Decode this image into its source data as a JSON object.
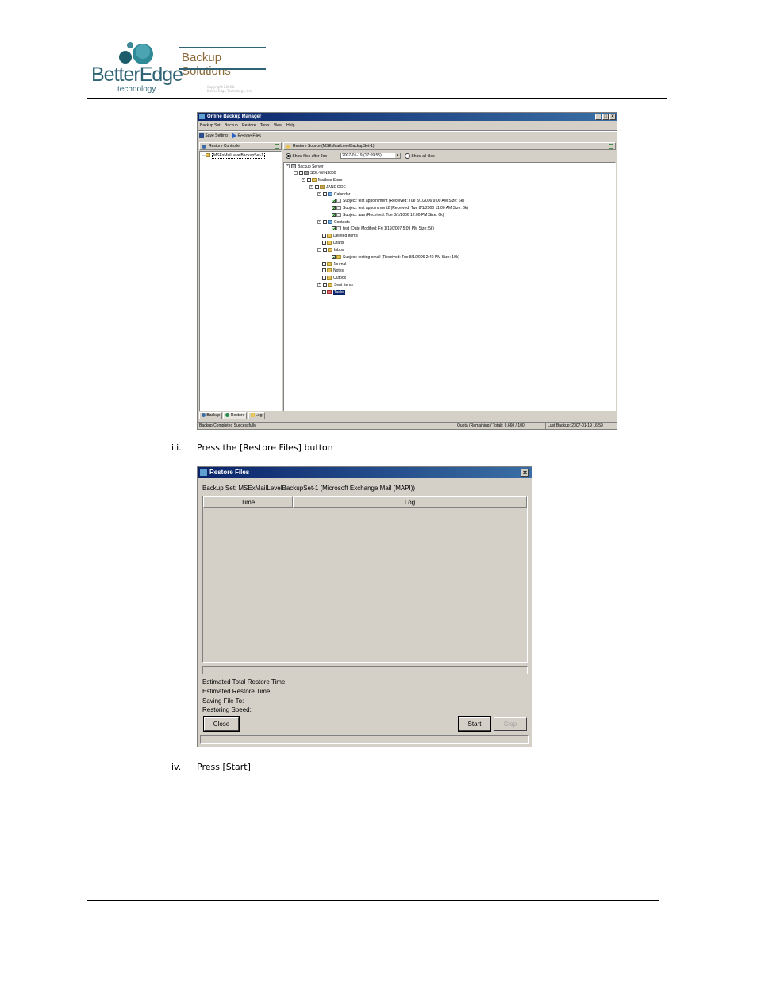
{
  "logo": {
    "brand_line1": "BetterEdge",
    "brand_line2": "technology",
    "product": "Backup Solutions",
    "copyright_line1": "Copyright 2006©",
    "copyright_line2": "Better Edge Technology, Inc."
  },
  "obm_window": {
    "title": "Online Backup Manager",
    "menu": [
      "Backup Set",
      "Backup",
      "Restore",
      "Tools",
      "View",
      "Help"
    ],
    "toolbar": {
      "save_label": "Save Setting",
      "restore_label": "Restore Files"
    },
    "left_panel": {
      "title": "Restore Controller",
      "item": "MSExMailLevelBackupSet-1"
    },
    "right_panel": {
      "title": "Restore Source (MSExMailLevelBackupSet-1)",
      "radio_after": "Show files after Job",
      "job_date": "2007-01-19 (17:09:55)",
      "radio_all": "Show all files"
    },
    "tree": [
      "Backup Server",
      "SOL-WIN2000",
      "Mailbox Store",
      "JANE DOE",
      "Calendar",
      "Subject: test appointment (Received: Tue 8/1/2006 9:00 AM Size: 6k)",
      "Subject: test appointment2 (Received: Tue 8/1/2006 11:00 AM Size: 6k)",
      "Subject: aaa (Received: Tue 8/1/2006 12:00 PM Size: 6k)",
      "Contacts",
      "test (Date Modified: Fri 1/19/2007 5:09 PM Size: 5k)",
      "Deleted Items",
      "Drafts",
      "Inbox",
      "Subject: testing email (Received: Tue 8/1/2006 2:40 PM Size: 10k)",
      "Journal",
      "Notes",
      "Outbox",
      "Sent Items",
      "Tasks"
    ],
    "tabs": [
      "Backup",
      "Restore",
      "Log"
    ],
    "status": {
      "left": "Backup Completed Successfully",
      "quota": "Quota (Remaining / Total): 9.660 / 100",
      "last_backup": "Last Backup: 2007-01-19 16:59"
    }
  },
  "step_iii": {
    "num": "iii.",
    "text": "Press the [Restore Files] button"
  },
  "restore_dialog": {
    "title": "Restore Files",
    "backup_set": "Backup Set: MSExMailLevelBackupSet-1 (Microsoft Exchange Mail (MAPI))",
    "col_time": "Time",
    "col_log": "Log",
    "est_total": "Estimated Total Restore Time:",
    "est_restore": "Estimated Restore Time:",
    "saving": "Saving File To:",
    "speed": "Restoring Speed:",
    "close": "Close",
    "start": "Start",
    "stop": "Stop"
  },
  "step_iv": {
    "num": "iv.",
    "text": "Press [Start]"
  },
  "colors": {
    "accent": "#2f6374",
    "titlebar": "#0a246a",
    "window_bg": "#d4d0c8"
  }
}
